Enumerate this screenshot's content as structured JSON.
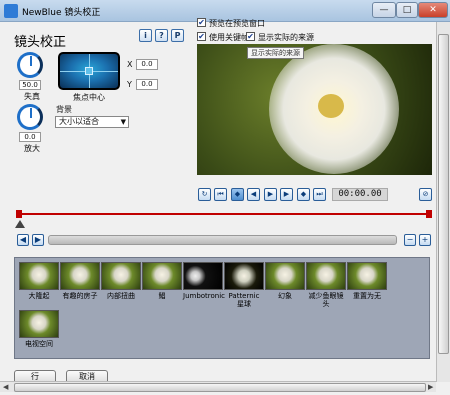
{
  "window": {
    "title": "NewBlue 镜头校正",
    "minimize": "—",
    "maximize": "□",
    "close": "✕"
  },
  "panel": {
    "heading": "镜头校正",
    "help_buttons": [
      "i",
      "?",
      "P"
    ]
  },
  "distortion": {
    "value": "50.0",
    "label": "失真"
  },
  "zoom": {
    "value": "0.0",
    "label": "放大"
  },
  "focus": {
    "label": "焦点中心",
    "x_label": "X",
    "x_value": "0.0",
    "y_label": "Y",
    "y_value": "0.0"
  },
  "background": {
    "label": "背景",
    "selected": "大小以适合"
  },
  "options": {
    "show_in_preview": {
      "label": "预览在预览窗口",
      "checked": true
    },
    "use_keyframes": {
      "label": "使用关键帧",
      "checked": true
    },
    "show_actual_source": {
      "label": "显示实际的来源",
      "checked": true
    }
  },
  "tooltip": "显示实际的来源",
  "transport": {
    "buttons": [
      "loop-icon",
      "go-start-icon",
      "prev-keyframe-icon",
      "step-back-icon",
      "play-icon",
      "step-forward-icon",
      "next-keyframe-icon",
      "go-end-icon"
    ],
    "timecode": "00:00.00"
  },
  "presets": [
    {
      "label": "大隆起",
      "style": "light"
    },
    {
      "label": "有趣的房子",
      "style": "light"
    },
    {
      "label": "内部扭曲",
      "style": "light"
    },
    {
      "label": "鲳",
      "style": "light"
    },
    {
      "label": "Jumbotronic",
      "style": "dark"
    },
    {
      "label": "Patternic 星球",
      "style": "planet"
    },
    {
      "label": "幻象",
      "style": "light"
    },
    {
      "label": "减少鱼眼镜头",
      "style": "light"
    },
    {
      "label": "重置为无",
      "style": "light"
    },
    {
      "label": "电视空间",
      "style": "light"
    }
  ],
  "footer": {
    "ok_label": "行",
    "cancel_label": "取消"
  },
  "colors": {
    "accent": "#1e6fc8",
    "timeline": "#c00000",
    "preset_panel": "#9ea6b6"
  }
}
